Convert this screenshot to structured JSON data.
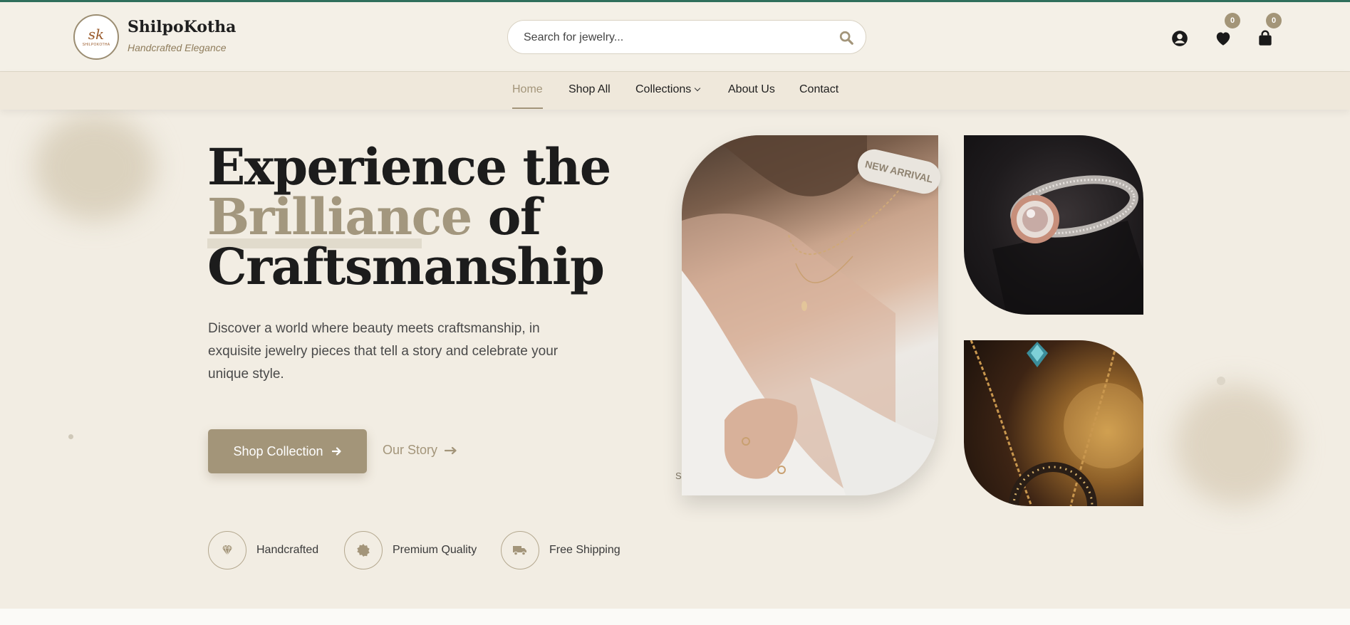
{
  "header": {
    "logo_mark": "sk",
    "logo_small": "SHILPOKOTHA",
    "brand_name": "ShilpoKotha",
    "tagline": "Handcrafted Elegance",
    "search_placeholder": "Search for jewelry...",
    "wishlist_count": "0",
    "cart_count": "0"
  },
  "nav": {
    "items": [
      {
        "label": "Home",
        "active": true
      },
      {
        "label": "Shop All"
      },
      {
        "label": "Collections"
      },
      {
        "label": "About Us"
      },
      {
        "label": "Contact"
      }
    ]
  },
  "hero": {
    "title_line1": "Experience the",
    "title_highlight": "Brilliance",
    "title_line2_rest": " of",
    "title_line3": "Craftsmanship",
    "description": "Discover a world where beauty meets craftsmanship, in exquisite jewelry pieces that tell a story and celebrate your unique style.",
    "primary_button": "Shop Collection",
    "secondary_button": "Our Story",
    "features": [
      {
        "label": "Handcrafted",
        "icon": "gem-icon"
      },
      {
        "label": "Premium Quality",
        "icon": "badge-icon"
      },
      {
        "label": "Free Shipping",
        "icon": "truck-icon"
      }
    ],
    "tag": "NEW ARRIVAL",
    "stray_text": "S"
  },
  "colors": {
    "accent": "#a39579",
    "background": "#f2ede3",
    "top_border": "#2f6f5c"
  }
}
